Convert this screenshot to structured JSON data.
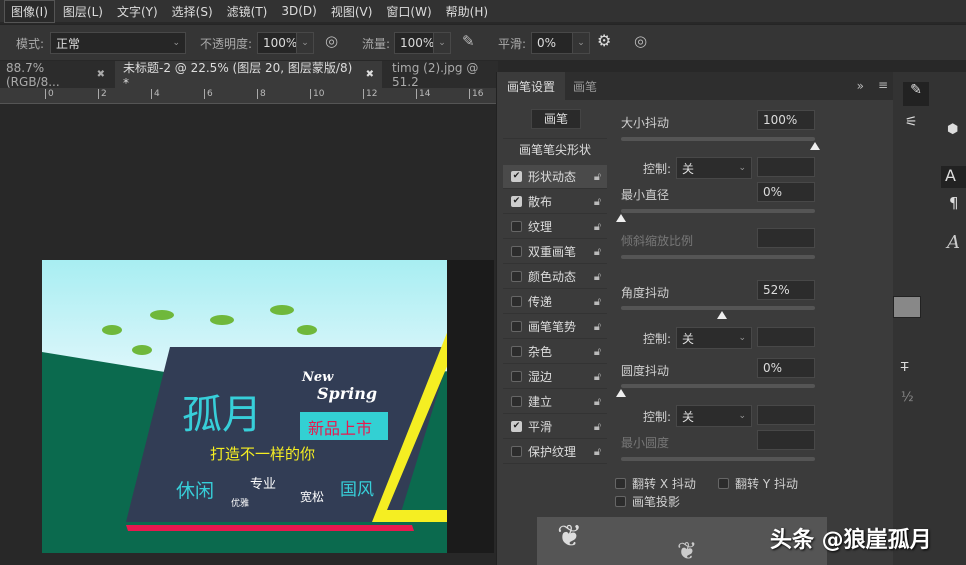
{
  "menu": [
    "图像(I)",
    "图层(L)",
    "文字(Y)",
    "选择(S)",
    "滤镜(T)",
    "3D(D)",
    "视图(V)",
    "窗口(W)",
    "帮助(H)"
  ],
  "options": {
    "mode_label": "模式:",
    "mode_value": "正常",
    "opacity_label": "不透明度:",
    "opacity_value": "100%",
    "flow_label": "流量:",
    "flow_value": "100%",
    "smooth_label": "平滑:",
    "smooth_value": "0%"
  },
  "tabs": [
    {
      "label": "88.7%(RGB/8..."
    },
    {
      "label": "未标题-2 @ 22.5% (图层 20, 图层蒙版/8) *"
    },
    {
      "label": "timg (2).jpg @ 51.2"
    }
  ],
  "ruler": [
    "0",
    "2",
    "4",
    "6",
    "8",
    "10",
    "12",
    "14",
    "16"
  ],
  "panel": {
    "tabs": [
      "画笔设置",
      "画笔"
    ],
    "brush_button": "画笔",
    "tip_shape": "画笔笔尖形状",
    "items": [
      {
        "label": "形状动态",
        "checked": true
      },
      {
        "label": "散布",
        "checked": true
      },
      {
        "label": "纹理",
        "checked": false
      },
      {
        "label": "双重画笔",
        "checked": false
      },
      {
        "label": "颜色动态",
        "checked": false
      },
      {
        "label": "传递",
        "checked": false
      },
      {
        "label": "画笔笔势",
        "checked": false
      },
      {
        "label": "杂色",
        "checked": false
      },
      {
        "label": "湿边",
        "checked": false
      },
      {
        "label": "建立",
        "checked": false
      },
      {
        "label": "平滑",
        "checked": true
      },
      {
        "label": "保护纹理",
        "checked": false
      }
    ],
    "size_jitter_label": "大小抖动",
    "size_jitter": "100%",
    "size_jitter_pct": 100,
    "control_label": "控制:",
    "control_value": "关",
    "min_diameter_label": "最小直径",
    "min_diameter": "0%",
    "min_diameter_pct": 0,
    "tilt_scale_label": "倾斜缩放比例",
    "angle_jitter_label": "角度抖动",
    "angle_jitter": "52%",
    "angle_jitter_pct": 52,
    "roundness_jitter_label": "圆度抖动",
    "roundness_jitter": "0%",
    "roundness_jitter_pct": 0,
    "min_roundness_label": "最小圆度",
    "flip_x": "翻转 X 抖动",
    "flip_y": "翻转 Y 抖动",
    "projection": "画笔投影"
  },
  "banner": {
    "title": "孤月",
    "new": "New",
    "spring": "Spring",
    "badge": "新品上市",
    "slogan": "打造不一样的你",
    "w1": "休闲",
    "w2": "优雅",
    "w3": "专业",
    "w4": "宽松",
    "w5": "国风"
  },
  "watermark": "头条 @狼崖孤月"
}
